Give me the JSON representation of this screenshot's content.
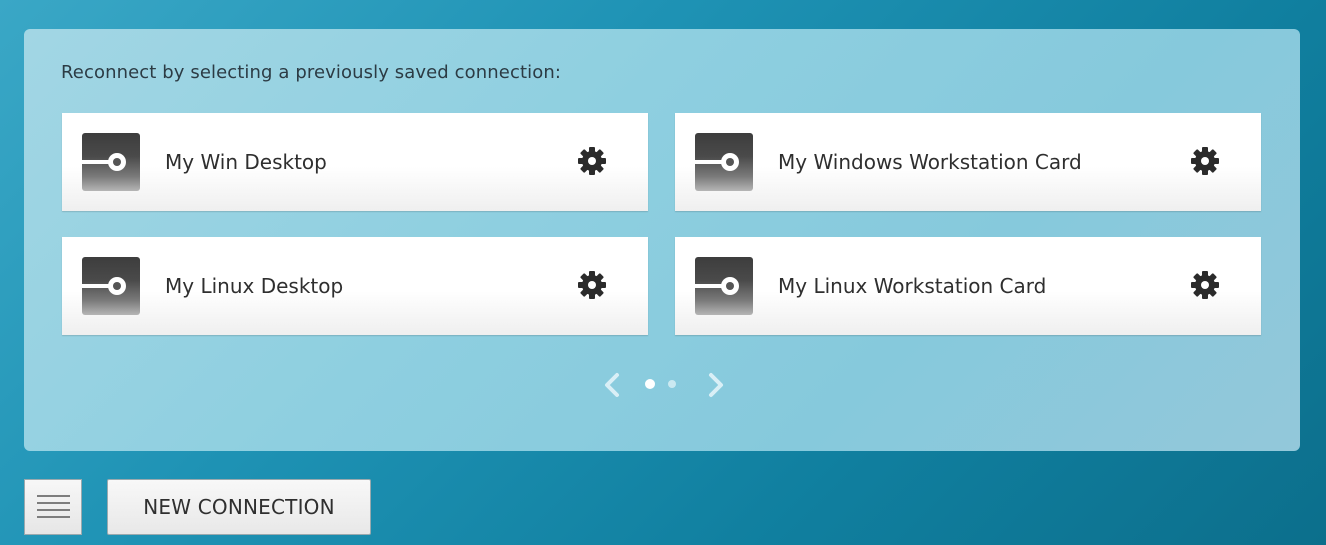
{
  "heading": "Reconnect by selecting a previously saved connection:",
  "connections": [
    {
      "name": "My Win Desktop",
      "icon": "connection-icon",
      "settings_icon": "gear-icon"
    },
    {
      "name": "My Windows Workstation Card",
      "icon": "connection-icon",
      "settings_icon": "gear-icon"
    },
    {
      "name": "My Linux Desktop",
      "icon": "connection-icon",
      "settings_icon": "gear-icon"
    },
    {
      "name": "My Linux Workstation Card",
      "icon": "connection-icon",
      "settings_icon": "gear-icon"
    }
  ],
  "pager": {
    "current_page": 1,
    "total_pages": 2,
    "prev_icon": "chevron-left-icon",
    "next_icon": "chevron-right-icon"
  },
  "toolbar": {
    "menu_icon": "hamburger-menu-icon",
    "new_connection_label": "NEW CONNECTION"
  },
  "colors": {
    "background": "#1f93b5",
    "panel": "#8ecfe0",
    "card": "#ffffff",
    "text": "#2f2f2f",
    "gear": "#2b2b2b"
  }
}
